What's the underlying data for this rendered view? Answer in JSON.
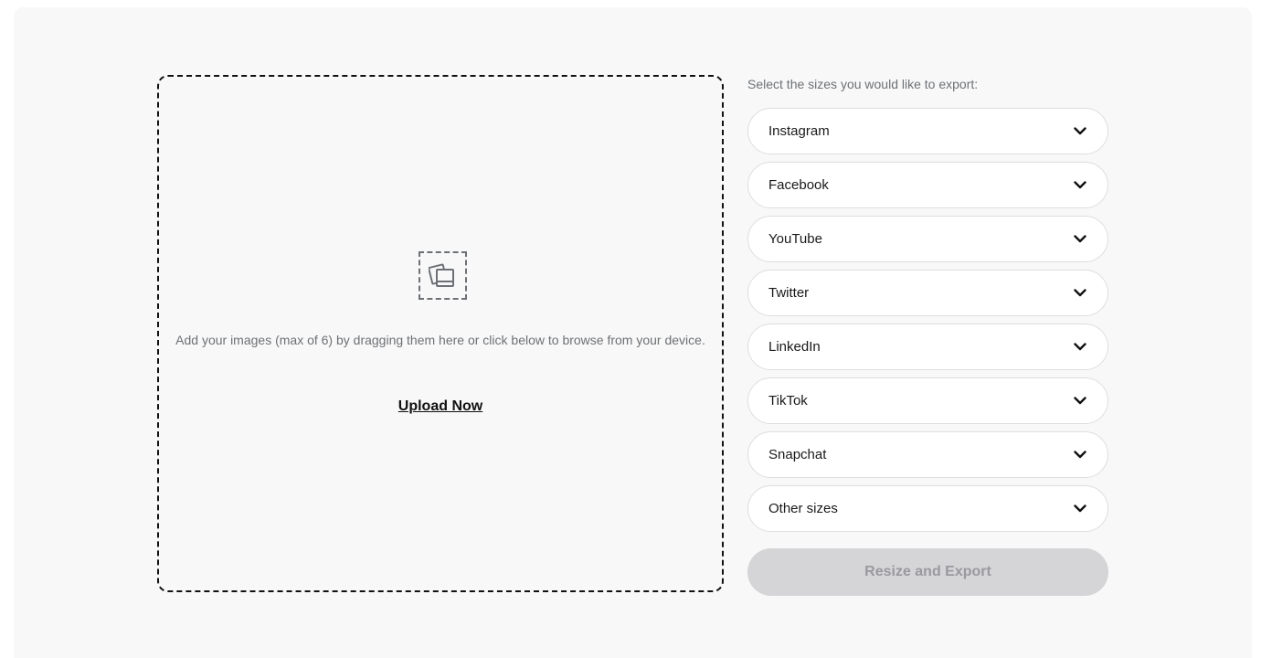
{
  "dropzone": {
    "icon": "photos-icon",
    "instructions": "Add your images (max of 6) by dragging them here or click below to browse from your device.",
    "upload_label": "Upload Now"
  },
  "sizes": {
    "heading": "Select the sizes you would like to export:",
    "items": [
      {
        "label": "Instagram",
        "icon": "chevron-down-icon"
      },
      {
        "label": "Facebook",
        "icon": "chevron-down-icon"
      },
      {
        "label": "YouTube",
        "icon": "chevron-down-icon"
      },
      {
        "label": "Twitter",
        "icon": "chevron-down-icon"
      },
      {
        "label": "LinkedIn",
        "icon": "chevron-down-icon"
      },
      {
        "label": "TikTok",
        "icon": "chevron-down-icon"
      },
      {
        "label": "Snapchat",
        "icon": "chevron-down-icon"
      },
      {
        "label": "Other sizes",
        "icon": "chevron-down-icon"
      }
    ]
  },
  "export_button": {
    "label": "Resize and Export",
    "disabled": true
  },
  "colors": {
    "panel_bg": "#f8f8f8",
    "text_muted": "#6d7175",
    "button_disabled_bg": "#d5d5d7",
    "button_disabled_text": "#9a9a9e"
  }
}
